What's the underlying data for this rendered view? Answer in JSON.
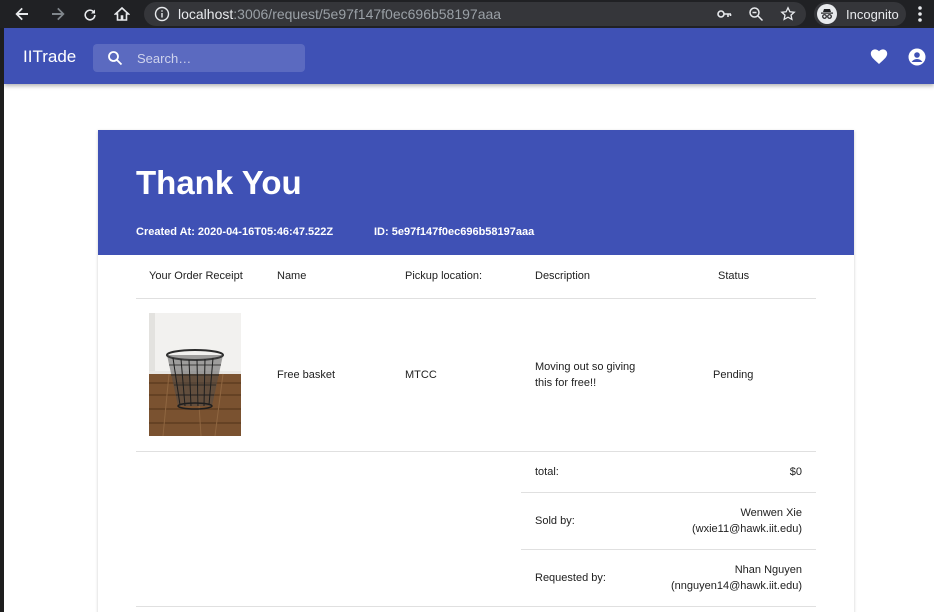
{
  "browser": {
    "url_host": "localhost",
    "url_rest": ":3006/request/5e97f147f0ec696b58197aaa",
    "incognito_label": "Incognito"
  },
  "appbar": {
    "brand": "IITrade",
    "search_placeholder": "Search…"
  },
  "receipt": {
    "title": "Thank You",
    "created_at": "Created At: 2020-04-16T05:46:47.522Z",
    "id": "ID: 5e97f147f0ec696b58197aaa",
    "columns": [
      "Your Order Receipt",
      "Name",
      "Pickup location:",
      "Description",
      "Status"
    ],
    "item": {
      "name": "Free basket",
      "pickup": "MTCC",
      "description": "Moving out so giving this for free!!",
      "status": "Pending"
    },
    "total_label": "total:",
    "total_value": "$0",
    "sold_by_label": "Sold by:",
    "sold_by_name": "Wenwen Xie",
    "sold_by_email": "(wxie11@hawk.iit.edu)",
    "requested_by_label": "Requested by:",
    "requested_by_name": "Nhan Nguyen",
    "requested_by_email": "(nnguyen14@hawk.iit.edu)"
  },
  "colors": {
    "primary": "#3f51b5",
    "browser_bg": "#202124"
  }
}
